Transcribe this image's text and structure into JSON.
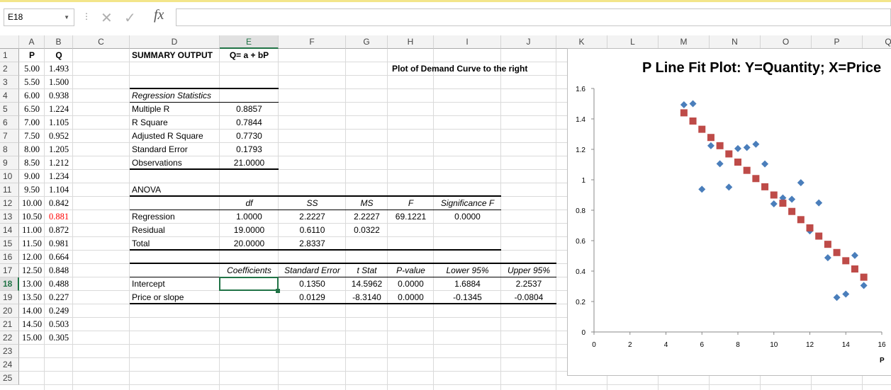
{
  "name_box": "E18",
  "formula_bar": {
    "value": "",
    "fx_label": "fx"
  },
  "columns": [
    "A",
    "B",
    "C",
    "D",
    "E",
    "F",
    "G",
    "H",
    "I",
    "J",
    "K",
    "L",
    "M",
    "N",
    "O",
    "P",
    "Q"
  ],
  "selected_column": "E",
  "selected_row": 18,
  "cells": {
    "A1": "P",
    "B1": "Q",
    "D1": "SUMMARY OUTPUT",
    "E1": "Q= a + bP",
    "A2": "5.00",
    "B2": "1.493",
    "H2": "Plot of  Demand Curve to the right",
    "A3": "5.50",
    "B3": "1.500",
    "A4": "6.00",
    "B4": "0.938",
    "D4": "Regression Statistics",
    "A5": "6.50",
    "B5": "1.224",
    "D5": "Multiple R",
    "E5": "0.8857",
    "A6": "7.00",
    "B6": "1.105",
    "D6": "R Square",
    "E6": "0.7844",
    "A7": "7.50",
    "B7": "0.952",
    "D7": "Adjusted R Square",
    "E7": "0.7730",
    "A8": "8.00",
    "B8": "1.205",
    "D8": "Standard Error",
    "E8": "0.1793",
    "A9": "8.50",
    "B9": "1.212",
    "D9": "Observations",
    "E9": "21.0000",
    "A10": "9.00",
    "B10": "1.234",
    "A11": "9.50",
    "B11": "1.104",
    "D11": "ANOVA",
    "A12": "10.00",
    "B12": "0.842",
    "E12": "df",
    "F12": "SS",
    "G12": "MS",
    "H12": "F",
    "I12": "Significance F",
    "A13": "10.50",
    "B13": "0.881",
    "D13": "Regression",
    "E13": "1.0000",
    "F13": "2.2227",
    "G13": "2.2227",
    "H13": "69.1221",
    "I13": "0.0000",
    "A14": "11.00",
    "B14": "0.872",
    "D14": "Residual",
    "E14": "19.0000",
    "F14": "0.6110",
    "G14": "0.0322",
    "A15": "11.50",
    "B15": "0.981",
    "D15": "Total",
    "E15": "20.0000",
    "F15": "2.8337",
    "A16": "12.00",
    "B16": "0.664",
    "A17": "12.50",
    "B17": "0.848",
    "E17": "Coefficients",
    "F17": "Standard Error",
    "G17": "t Stat",
    "H17": "P-value",
    "I17": "Lower 95%",
    "J17": "Upper 95%",
    "A18": "13.00",
    "B18": "0.488",
    "D18": "Intercept",
    "E18": "",
    "F18": "0.1350",
    "G18": "14.5962",
    "H18": "0.0000",
    "I18": "1.6884",
    "J18": "2.2537",
    "A19": "13.50",
    "B19": "0.227",
    "D19": "Price or slope",
    "F19": "0.0129",
    "G19": "-8.3140",
    "H19": "0.0000",
    "I19": "-0.1345",
    "J19": "-0.0804",
    "A20": "14.00",
    "B20": "0.249",
    "A21": "14.50",
    "B21": "0.503",
    "A22": "15.00",
    "B22": "0.305"
  },
  "highlight_color": "#ff0000",
  "chart_data": {
    "type": "scatter",
    "title": "P Line Fit  Plot: Y=Quantity; X=Price",
    "xlabel": "P",
    "ylabel": "",
    "xlim": [
      0,
      16
    ],
    "ylim": [
      0,
      1.6
    ],
    "xticks": [
      "0",
      "2",
      "4",
      "6",
      "8",
      "10",
      "12",
      "14",
      "16"
    ],
    "yticks": [
      "0",
      "0.2",
      "0.4",
      "0.6",
      "0.8",
      "1",
      "1.2",
      "1.4",
      "1.6"
    ],
    "grid": false,
    "legend": "none",
    "x": [
      5,
      5.5,
      6,
      6.5,
      7,
      7.5,
      8,
      8.5,
      9,
      9.5,
      10,
      10.5,
      11,
      11.5,
      12,
      12.5,
      13,
      13.5,
      14,
      14.5,
      15
    ],
    "series": [
      {
        "marker": "diamond",
        "color": "#4a7ebb",
        "values": [
          1.493,
          1.5,
          0.938,
          1.224,
          1.105,
          0.952,
          1.205,
          1.212,
          1.234,
          1.104,
          0.842,
          0.881,
          0.872,
          0.981,
          0.664,
          0.848,
          0.488,
          0.227,
          0.249,
          0.503,
          0.305
        ]
      },
      {
        "marker": "square",
        "color": "#be4b48",
        "values": [
          1.44,
          1.386,
          1.332,
          1.278,
          1.224,
          1.17,
          1.116,
          1.062,
          1.008,
          0.954,
          0.9,
          0.846,
          0.792,
          0.738,
          0.684,
          0.63,
          0.576,
          0.522,
          0.468,
          0.414,
          0.36
        ]
      }
    ]
  }
}
